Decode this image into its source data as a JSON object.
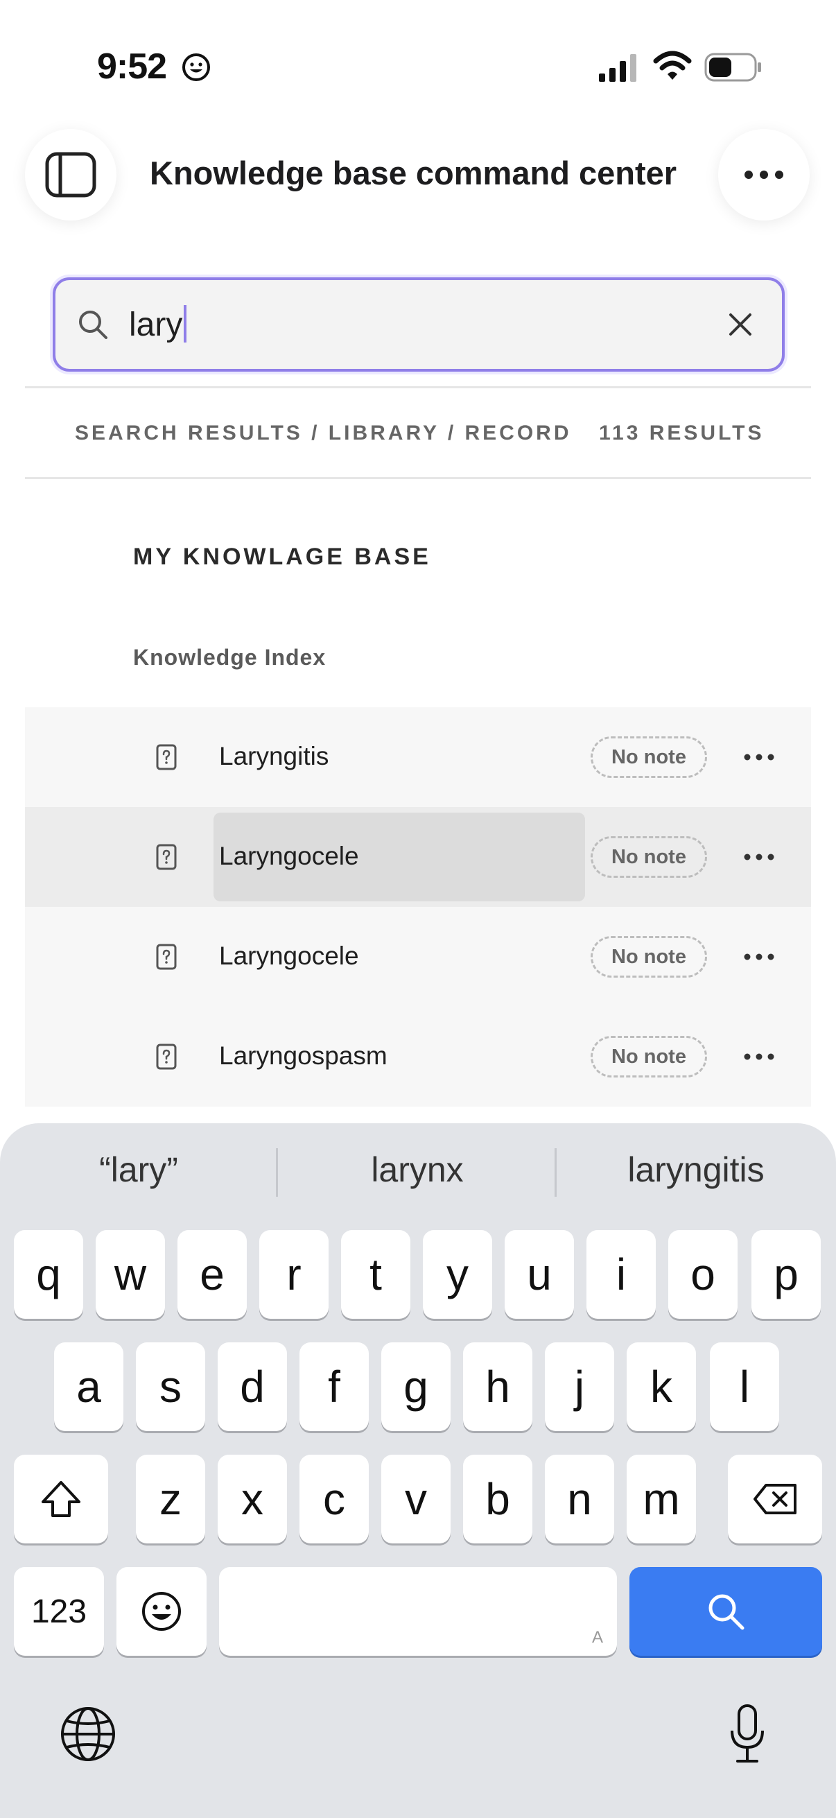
{
  "status_bar": {
    "time": "9:52"
  },
  "header": {
    "title": "Knowledge base command center"
  },
  "search": {
    "value": "lary"
  },
  "results_header": {
    "breadcrumb": "SEARCH RESULTS / LIBRARY / RECORD",
    "count": "113 RESULTS"
  },
  "section": {
    "title": "MY KNOWLAGE BASE",
    "subtitle": "Knowledge Index"
  },
  "results": [
    {
      "label": "Laryngitis",
      "badge": "No note",
      "selected": false
    },
    {
      "label": "Laryngocele",
      "badge": "No note",
      "selected": true
    },
    {
      "label": "Laryngocele",
      "badge": "No note",
      "selected": false
    },
    {
      "label": "Laryngospasm",
      "badge": "No note",
      "selected": false
    }
  ],
  "keyboard": {
    "suggestions": [
      "“lary”",
      "larynx",
      "laryngitis"
    ],
    "row1": [
      "q",
      "w",
      "e",
      "r",
      "t",
      "y",
      "u",
      "i",
      "o",
      "p"
    ],
    "row2": [
      "a",
      "s",
      "d",
      "f",
      "g",
      "h",
      "j",
      "k",
      "l"
    ],
    "row3": [
      "z",
      "x",
      "c",
      "v",
      "b",
      "n",
      "m"
    ],
    "numbers_key": "123",
    "space_hint": "A",
    "accent_color": "#3a7cf2"
  }
}
